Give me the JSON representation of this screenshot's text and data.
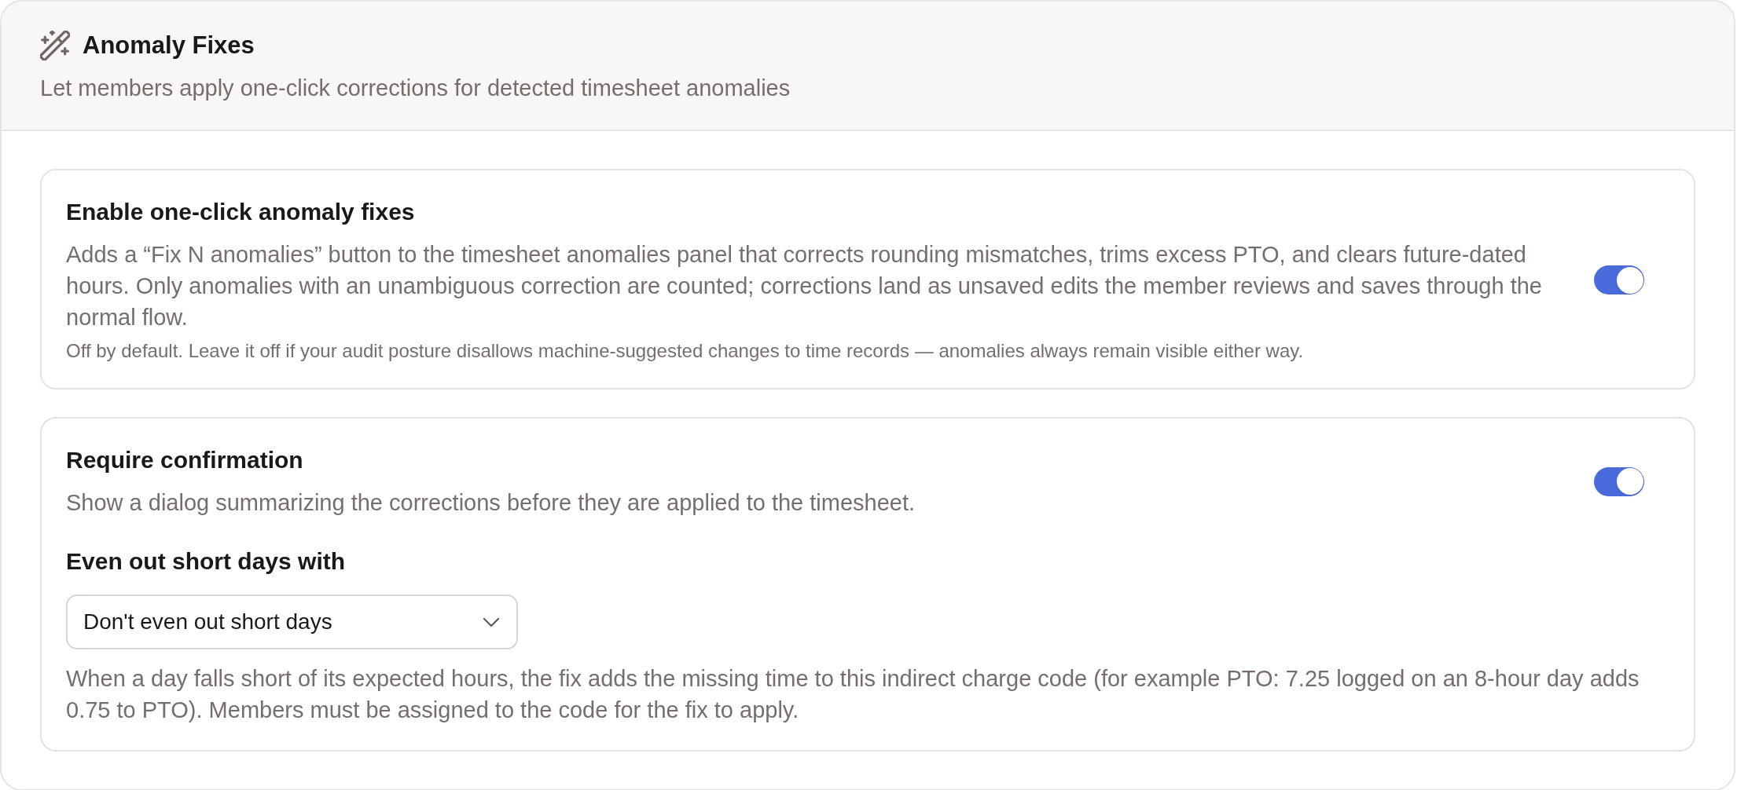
{
  "header": {
    "title": "Anomaly Fixes",
    "subtitle": "Let members apply one-click corrections for detected timesheet anomalies"
  },
  "cards": [
    {
      "title": "Enable one-click anomaly fixes",
      "description": "Adds a “Fix N anomalies” button to the timesheet anomalies panel that corrects rounding mismatches, trims excess PTO, and clears future-dated hours. Only anomalies with an unambiguous correction are counted; corrections land as unsaved edits the member reviews and saves through the normal flow.",
      "note": "Off by default. Leave it off if your audit posture disallows machine-suggested changes to time records — anomalies always remain visible either way.",
      "on": true
    },
    {
      "title": "Require confirmation",
      "description": "Show a dialog summarizing the corrections before they are applied to the timesheet.",
      "on": true,
      "field": {
        "label": "Even out short days with",
        "value": "Don't even out short days",
        "help": "When a day falls short of its expected hours, the fix adds the missing time to this indirect charge code (for example PTO: 7.25 logged on an 8-hour day adds 0.75 to PTO). Members must be assigned to the code for the fix to apply."
      }
    }
  ]
}
